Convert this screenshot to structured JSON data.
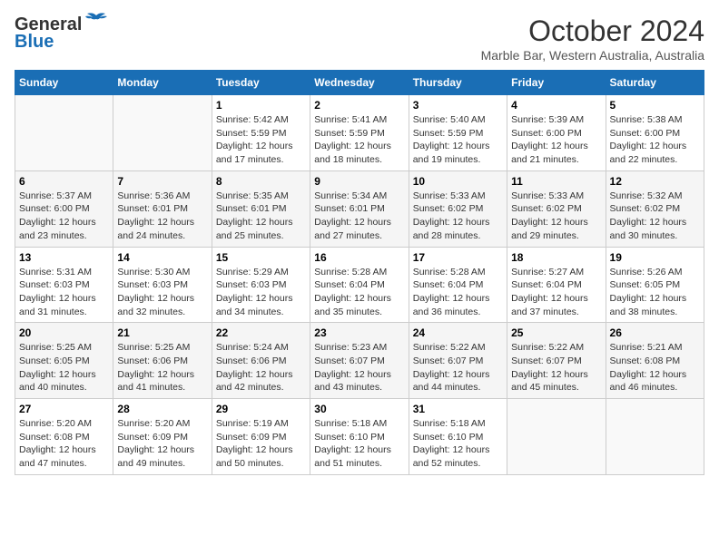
{
  "header": {
    "logo_line1": "General",
    "logo_line2": "Blue",
    "month": "October 2024",
    "location": "Marble Bar, Western Australia, Australia"
  },
  "days_of_week": [
    "Sunday",
    "Monday",
    "Tuesday",
    "Wednesday",
    "Thursday",
    "Friday",
    "Saturday"
  ],
  "weeks": [
    [
      {
        "day": "",
        "info": ""
      },
      {
        "day": "",
        "info": ""
      },
      {
        "day": "1",
        "info": "Sunrise: 5:42 AM\nSunset: 5:59 PM\nDaylight: 12 hours and 17 minutes."
      },
      {
        "day": "2",
        "info": "Sunrise: 5:41 AM\nSunset: 5:59 PM\nDaylight: 12 hours and 18 minutes."
      },
      {
        "day": "3",
        "info": "Sunrise: 5:40 AM\nSunset: 5:59 PM\nDaylight: 12 hours and 19 minutes."
      },
      {
        "day": "4",
        "info": "Sunrise: 5:39 AM\nSunset: 6:00 PM\nDaylight: 12 hours and 21 minutes."
      },
      {
        "day": "5",
        "info": "Sunrise: 5:38 AM\nSunset: 6:00 PM\nDaylight: 12 hours and 22 minutes."
      }
    ],
    [
      {
        "day": "6",
        "info": "Sunrise: 5:37 AM\nSunset: 6:00 PM\nDaylight: 12 hours and 23 minutes."
      },
      {
        "day": "7",
        "info": "Sunrise: 5:36 AM\nSunset: 6:01 PM\nDaylight: 12 hours and 24 minutes."
      },
      {
        "day": "8",
        "info": "Sunrise: 5:35 AM\nSunset: 6:01 PM\nDaylight: 12 hours and 25 minutes."
      },
      {
        "day": "9",
        "info": "Sunrise: 5:34 AM\nSunset: 6:01 PM\nDaylight: 12 hours and 27 minutes."
      },
      {
        "day": "10",
        "info": "Sunrise: 5:33 AM\nSunset: 6:02 PM\nDaylight: 12 hours and 28 minutes."
      },
      {
        "day": "11",
        "info": "Sunrise: 5:33 AM\nSunset: 6:02 PM\nDaylight: 12 hours and 29 minutes."
      },
      {
        "day": "12",
        "info": "Sunrise: 5:32 AM\nSunset: 6:02 PM\nDaylight: 12 hours and 30 minutes."
      }
    ],
    [
      {
        "day": "13",
        "info": "Sunrise: 5:31 AM\nSunset: 6:03 PM\nDaylight: 12 hours and 31 minutes."
      },
      {
        "day": "14",
        "info": "Sunrise: 5:30 AM\nSunset: 6:03 PM\nDaylight: 12 hours and 32 minutes."
      },
      {
        "day": "15",
        "info": "Sunrise: 5:29 AM\nSunset: 6:03 PM\nDaylight: 12 hours and 34 minutes."
      },
      {
        "day": "16",
        "info": "Sunrise: 5:28 AM\nSunset: 6:04 PM\nDaylight: 12 hours and 35 minutes."
      },
      {
        "day": "17",
        "info": "Sunrise: 5:28 AM\nSunset: 6:04 PM\nDaylight: 12 hours and 36 minutes."
      },
      {
        "day": "18",
        "info": "Sunrise: 5:27 AM\nSunset: 6:04 PM\nDaylight: 12 hours and 37 minutes."
      },
      {
        "day": "19",
        "info": "Sunrise: 5:26 AM\nSunset: 6:05 PM\nDaylight: 12 hours and 38 minutes."
      }
    ],
    [
      {
        "day": "20",
        "info": "Sunrise: 5:25 AM\nSunset: 6:05 PM\nDaylight: 12 hours and 40 minutes."
      },
      {
        "day": "21",
        "info": "Sunrise: 5:25 AM\nSunset: 6:06 PM\nDaylight: 12 hours and 41 minutes."
      },
      {
        "day": "22",
        "info": "Sunrise: 5:24 AM\nSunset: 6:06 PM\nDaylight: 12 hours and 42 minutes."
      },
      {
        "day": "23",
        "info": "Sunrise: 5:23 AM\nSunset: 6:07 PM\nDaylight: 12 hours and 43 minutes."
      },
      {
        "day": "24",
        "info": "Sunrise: 5:22 AM\nSunset: 6:07 PM\nDaylight: 12 hours and 44 minutes."
      },
      {
        "day": "25",
        "info": "Sunrise: 5:22 AM\nSunset: 6:07 PM\nDaylight: 12 hours and 45 minutes."
      },
      {
        "day": "26",
        "info": "Sunrise: 5:21 AM\nSunset: 6:08 PM\nDaylight: 12 hours and 46 minutes."
      }
    ],
    [
      {
        "day": "27",
        "info": "Sunrise: 5:20 AM\nSunset: 6:08 PM\nDaylight: 12 hours and 47 minutes."
      },
      {
        "day": "28",
        "info": "Sunrise: 5:20 AM\nSunset: 6:09 PM\nDaylight: 12 hours and 49 minutes."
      },
      {
        "day": "29",
        "info": "Sunrise: 5:19 AM\nSunset: 6:09 PM\nDaylight: 12 hours and 50 minutes."
      },
      {
        "day": "30",
        "info": "Sunrise: 5:18 AM\nSunset: 6:10 PM\nDaylight: 12 hours and 51 minutes."
      },
      {
        "day": "31",
        "info": "Sunrise: 5:18 AM\nSunset: 6:10 PM\nDaylight: 12 hours and 52 minutes."
      },
      {
        "day": "",
        "info": ""
      },
      {
        "day": "",
        "info": ""
      }
    ]
  ]
}
